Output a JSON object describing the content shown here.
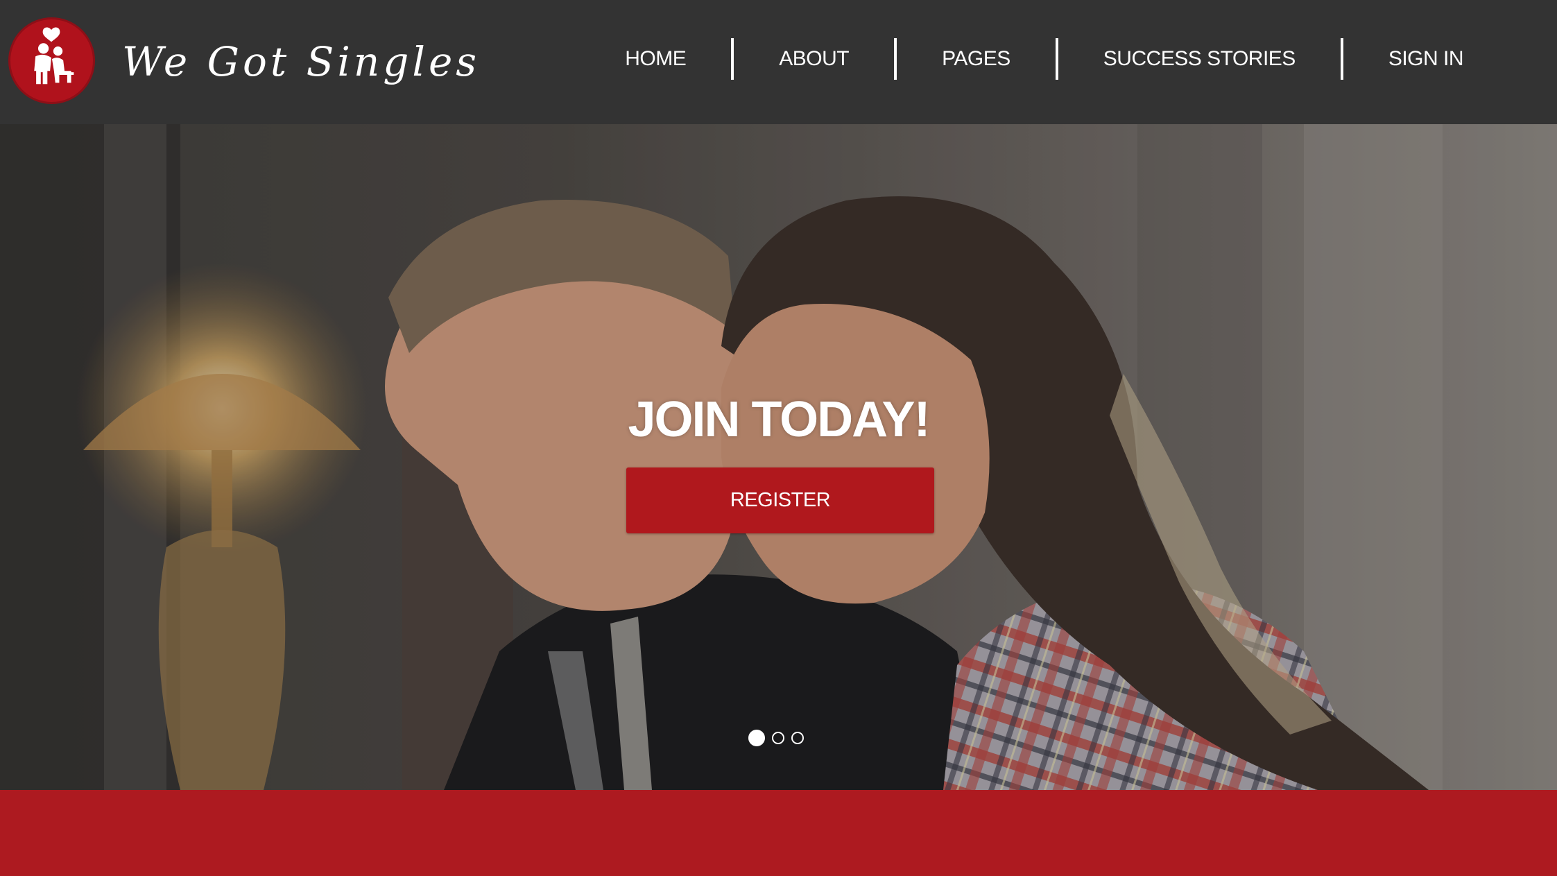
{
  "brand": {
    "name": "We Got Singles",
    "logo_icon": "couple-heart-icon",
    "logo_color": "#b0121c"
  },
  "nav": {
    "items": [
      {
        "label": "HOME"
      },
      {
        "label": "ABOUT"
      },
      {
        "label": "PAGES"
      },
      {
        "label": "SUCCESS STORIES"
      },
      {
        "label": "SIGN IN"
      }
    ]
  },
  "hero": {
    "title": "JOIN TODAY!",
    "cta_label": "REGISTER",
    "slides_total": 3,
    "active_slide": 1
  },
  "colors": {
    "header_bg": "#333333",
    "accent_red": "#b0181d",
    "band_red": "#ad1a20"
  }
}
